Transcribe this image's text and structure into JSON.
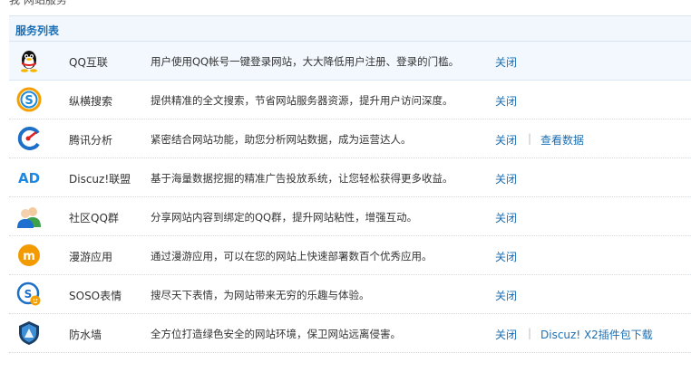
{
  "top_fragment": "我       网站服务",
  "panel": {
    "title": "服务列表",
    "rows": [
      {
        "icon": "qq-penguin-icon",
        "name": "QQ互联",
        "desc": "用户使用QQ帐号一键登录网站，大大降低用户注册、登录的门槛。",
        "action": "关闭",
        "extra": ""
      },
      {
        "icon": "soso-search-icon",
        "name": "纵横搜索",
        "desc": "提供精准的全文搜索，节省网站服务器资源，提升用户访问深度。",
        "action": "关闭",
        "extra": ""
      },
      {
        "icon": "analytics-icon",
        "name": "腾讯分析",
        "desc": "紧密结合网站功能，助您分析网站数据，成为运营达人。",
        "action": "关闭",
        "extra": "查看数据"
      },
      {
        "icon": "ad-icon",
        "name": "Discuz!联盟",
        "desc": "基于海量数据挖掘的精准广告投放系统，让您轻松获得更多收益。",
        "action": "关闭",
        "extra": ""
      },
      {
        "icon": "qq-group-icon",
        "name": "社区QQ群",
        "desc": "分享网站内容到绑定的QQ群，提升网站粘性，增强互动。",
        "action": "关闭",
        "extra": ""
      },
      {
        "icon": "manyou-icon",
        "name": "漫游应用",
        "desc": "通过漫游应用，可以在您的网站上快速部署数百个优秀应用。",
        "action": "关闭",
        "extra": ""
      },
      {
        "icon": "soso-emoticon-icon",
        "name": "SOSO表情",
        "desc": "搜尽天下表情，为网站带来无穷的乐趣与体验。",
        "action": "关闭",
        "extra": ""
      },
      {
        "icon": "firewall-shield-icon",
        "name": "防水墙",
        "desc": "全方位打造绿色安全的网站环境，保卫网站远离侵害。",
        "action": "关闭",
        "extra": "Discuz! X2插件包下载"
      }
    ]
  }
}
